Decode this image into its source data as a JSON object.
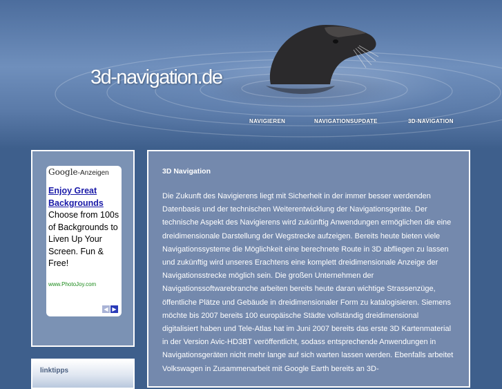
{
  "site": {
    "title": "3d-navigation.de"
  },
  "nav": {
    "items": [
      {
        "label": "NAVIGIEREN"
      },
      {
        "label": "NAVIGATIONSUPDATE"
      },
      {
        "label": "3D-NAVIGATION"
      }
    ]
  },
  "ad": {
    "label_brand": "Google",
    "label_suffix": "-Anzeigen",
    "headline": "Enjoy Great Backgrounds",
    "body": "Choose from 100s of Backgrounds to Liven Up Your Screen. Fun & Free!",
    "url": "www.PhotoJoy.com"
  },
  "linktipps": {
    "title": "linktipps"
  },
  "content": {
    "title": "3D Navigation",
    "body": "Die Zukunft des Navigierens liegt mit Sicherheit in der immer besser werdenden Datenbasis und der technischen Weiterentwicklung der Navigationsgeräte. Der technische Aspekt des Navigierens wird zukünftig Anwendungen ermöglichen die eine dreidimensionale Darstellung der Wegstrecke aufzeigen. Bereits heute bieten viele Navigationssysteme die Möglichkeit eine berechnete Route in 3D abfliegen zu lassen und zukünftig wird unseres Erachtens eine komplett dreidimensionale Anzeige der Navigationsstrecke möglich sein. Die großen Unternehmen der Navigationssoftwarebranche arbeiten bereits heute daran wichtige Strassenzüge, öffentliche Plätze und Gebäude in dreidimensionaler Form zu katalogisieren. Siemens möchte bis 2007 bereits 100 europäische Städte vollständig dreidimensional digitalisiert haben und Tele-Atlas hat im Juni 2007 bereits das erste 3D Kartenmaterial in der Version Avic-HD3BT veröffentlicht, sodass entsprechende Anwendungen in Navigationsgeräten nicht mehr lange auf sich warten lassen werden. Ebenfalls arbeitet Volkswagen in Zusammenarbeit mit Google Earth bereits an 3D-"
  }
}
